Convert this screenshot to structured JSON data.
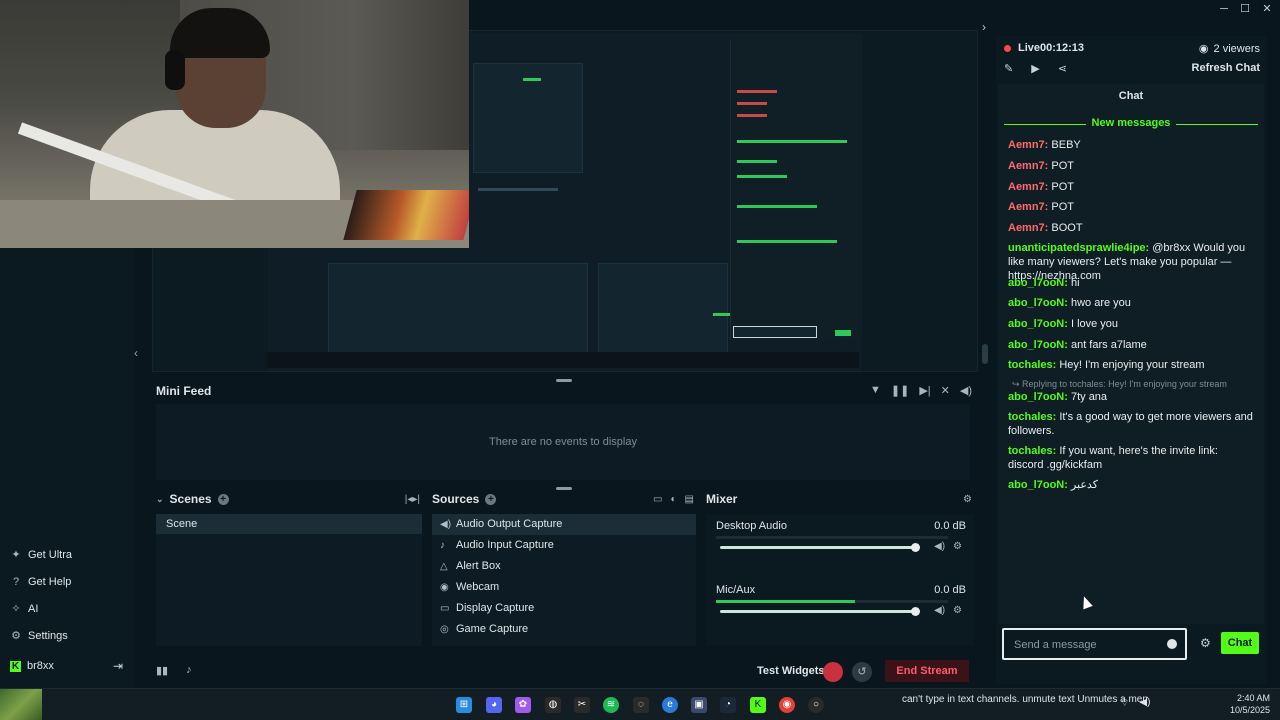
{
  "colors": {
    "kick_green": "#53fc18",
    "live_red": "#ff4747",
    "end_stream_red": "#ff5b6a",
    "bg": "#09161e"
  },
  "window": {
    "minimize": "─",
    "maximize": "☐",
    "close": "✕"
  },
  "preview": {
    "empty_text": "There are no events to display"
  },
  "leftnav": {
    "items": [
      {
        "label": "Get Ultra",
        "icon": "sparkle-icon"
      },
      {
        "label": "Get Help",
        "icon": "help-icon"
      },
      {
        "label": "AI",
        "icon": "ai-icon"
      },
      {
        "label": "Settings",
        "icon": "gear-icon"
      }
    ],
    "user": "br8xx"
  },
  "minifeed": {
    "title": "Mini Feed",
    "empty": "There are no events to display"
  },
  "scenes": {
    "title": "Scenes",
    "items": [
      "Scene"
    ]
  },
  "sources": {
    "title": "Sources",
    "items": [
      "Audio Output Capture",
      "Audio Input Capture",
      "Alert Box",
      "Webcam",
      "Display Capture",
      "Game Capture"
    ]
  },
  "mixer": {
    "title": "Mixer",
    "channels": [
      {
        "name": "Desktop Audio",
        "db": "0.0 dB",
        "level": 0,
        "fader": 1.0
      },
      {
        "name": "Mic/Aux",
        "db": "0.0 dB",
        "level": 0.6,
        "fader": 1.0
      }
    ]
  },
  "bottombar": {
    "test_widgets": "Test Widgets",
    "end_stream": "End Stream"
  },
  "chat": {
    "live": "Live00:12:13",
    "viewers": "2 viewers",
    "refresh": "Refresh Chat",
    "title": "Chat",
    "new_messages": "New messages",
    "messages": [
      {
        "user": "Aemn7:",
        "text": " BEBY",
        "color": "#ff6b6b"
      },
      {
        "user": "Aemn7:",
        "text": " POT",
        "color": "#ff6b6b"
      },
      {
        "user": "Aemn7:",
        "text": " POT",
        "color": "#ff6b6b"
      },
      {
        "user": "Aemn7:",
        "text": " POT",
        "color": "#ff6b6b"
      },
      {
        "user": "Aemn7:",
        "text": " BOOT",
        "color": "#ff6b6b"
      },
      {
        "user": "unanticipatedsprawlie4ipe:",
        "text": " @br8xx Would you like many viewers? Let's make you popular — https://nezhna.com",
        "color": "#53fc18"
      },
      {
        "user": "abo_l7ooN:",
        "text": " hi",
        "color": "#53fc18"
      },
      {
        "user": "abo_l7ooN:",
        "text": " hwo are you",
        "color": "#53fc18"
      },
      {
        "user": "abo_l7ooN:",
        "text": " I love you",
        "color": "#53fc18"
      },
      {
        "user": "abo_l7ooN:",
        "text": " ant fars a7lame",
        "color": "#53fc18"
      },
      {
        "user": "tochales:",
        "text": " Hey! I'm enjoying your stream",
        "color": "#53fc18"
      },
      {
        "user": "abo_l7ooN:",
        "text": " 7ty ana",
        "color": "#53fc18"
      },
      {
        "user": "tochales:",
        "text": " It's a good way to get more viewers and followers.",
        "color": "#53fc18"
      },
      {
        "user": "tochales:",
        "text": " If you want, here's the invite link: discord .gg/kickfam",
        "color": "#53fc18"
      },
      {
        "user": "abo_l7ooN:",
        "text": " كدعبر",
        "color": "#53fc18"
      }
    ],
    "reply_note": "↪ Replying to tochales: Hey! I'm enjoying your stream",
    "placeholder": "Send a message",
    "send": "Chat"
  },
  "taskbar": {
    "notification": "can't type in text channels. unmute text Unmutes a member...",
    "time": "2:40 AM",
    "date": "10/5/2025"
  }
}
